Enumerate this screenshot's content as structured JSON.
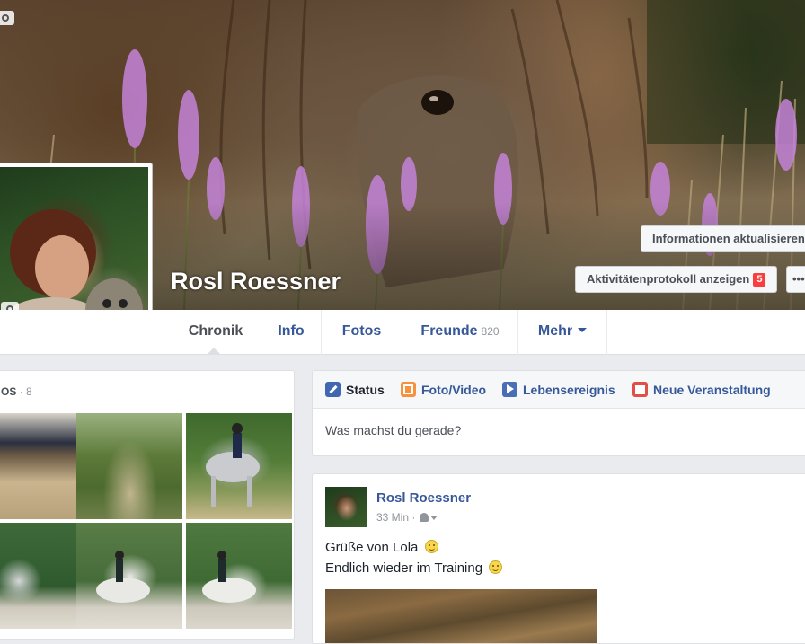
{
  "profile": {
    "name": "Rosl Roessner"
  },
  "cover_actions": {
    "update_info_label": "Informationen aktualisieren",
    "activity_log_label": "Aktivitätenprotokoll anzeigen",
    "activity_log_badge": "5",
    "more_label": "•••"
  },
  "tabs": [
    {
      "label": "Chronik",
      "count": ""
    },
    {
      "label": "Info",
      "count": ""
    },
    {
      "label": "Fotos",
      "count": ""
    },
    {
      "label": "Freunde",
      "count": "820"
    },
    {
      "label": "Mehr",
      "count": ""
    }
  ],
  "photos_box": {
    "title": "OS",
    "count": "· 8"
  },
  "composer": {
    "tabs": [
      {
        "label": "Status"
      },
      {
        "label": "Foto/Video"
      },
      {
        "label": "Lebensereignis"
      },
      {
        "label": "Neue Veranstaltung"
      }
    ],
    "placeholder": "Was machst du gerade?"
  },
  "post": {
    "author": "Rosl Roessner",
    "time": "33 Min ·",
    "lines": [
      "Grüße von Lola",
      "Endlich wieder im Training"
    ]
  },
  "colors": {
    "link_blue": "#365899",
    "badge_red": "#fa3e3e",
    "background": "#e9ebee"
  }
}
